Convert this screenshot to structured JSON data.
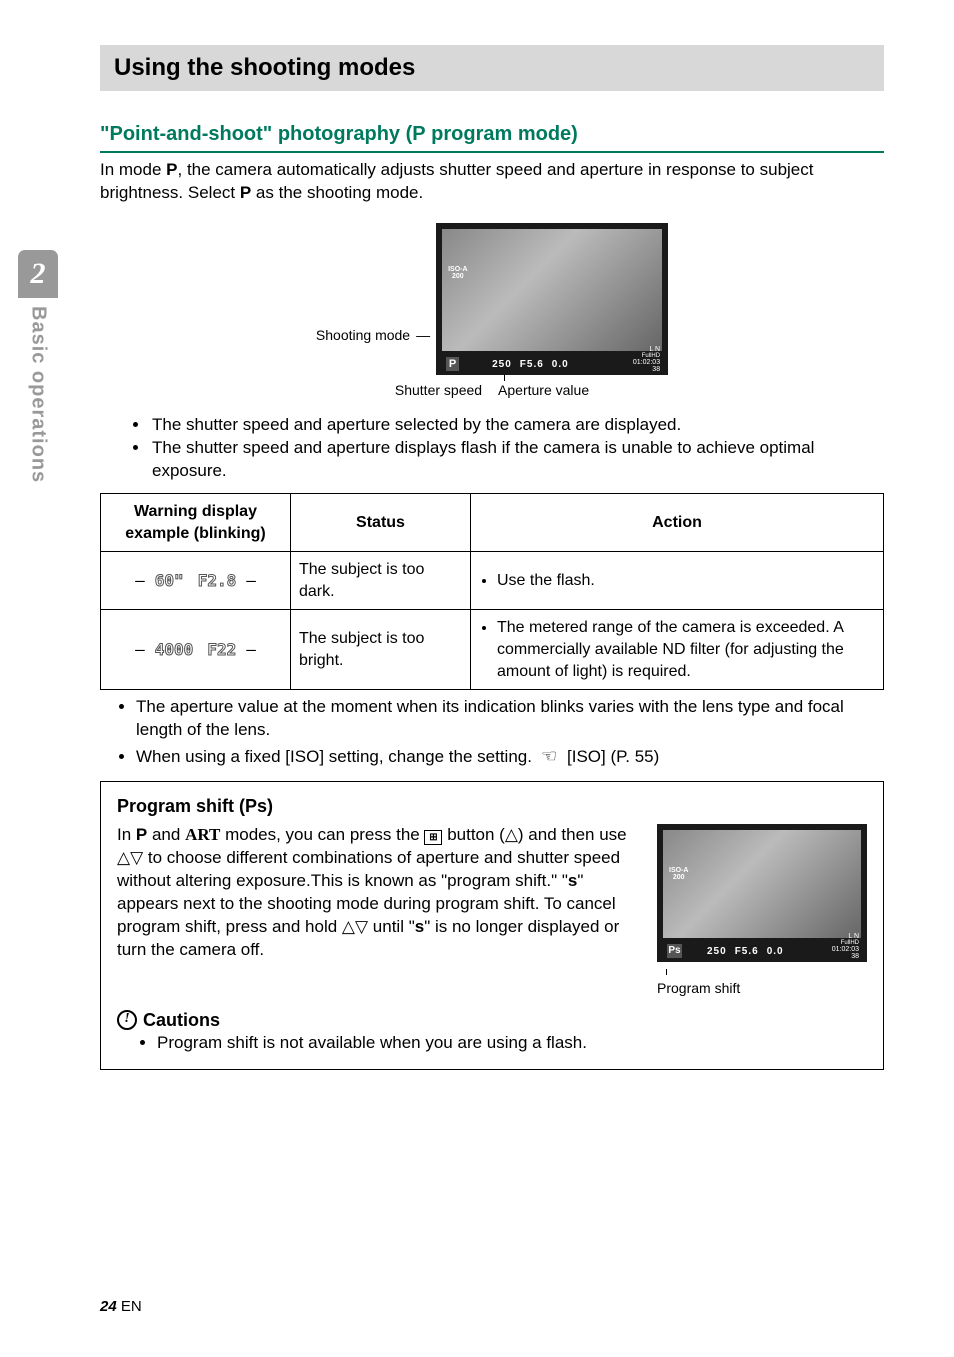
{
  "sideTab": {
    "chapter": "2",
    "label": "Basic operations"
  },
  "title": "Using the shooting modes",
  "section": {
    "heading_pre": "\"Point-and-shoot\" photography (",
    "heading_mode": "P",
    "heading_post": " program mode)",
    "intro1a": "In mode ",
    "intro1b": ", the camera automatically adjusts shutter speed and aperture in response to subject brightness. Select ",
    "intro1c": " as the shooting mode."
  },
  "fig1": {
    "shootingLabel": "Shooting mode",
    "iso": "ISO-A\n200",
    "pmode": "P",
    "shutter": "250",
    "aperture": "F5.6",
    "ev": "0.0",
    "time": "01:02:03",
    "frames": "38",
    "captionShutter": "Shutter speed",
    "captionAperture": "Aperture value"
  },
  "bullets1": [
    "The shutter speed and aperture selected by the camera are displayed.",
    "The shutter speed and aperture displays flash if the camera is unable to achieve optimal exposure."
  ],
  "table": {
    "headers": [
      "Warning display example (blinking)",
      "Status",
      "Action"
    ],
    "rows": [
      {
        "warn": {
          "a": "60\"",
          "b": "F2.8",
          "dashLeft": true,
          "dashRight": true
        },
        "status": "The subject is too dark.",
        "actions": [
          "Use the flash."
        ]
      },
      {
        "warn": {
          "a": "4000",
          "b": "F22",
          "dashLeft": true,
          "dashRight": true
        },
        "status": "The subject is too bright.",
        "actions": [
          "The metered range of the camera is exceeded. A commercially available ND filter (for adjusting the amount of light) is required."
        ]
      }
    ]
  },
  "notes": [
    "The aperture value at the moment when its indication blinks varies with the lens type and focal length of the lens.",
    "When using a fixed [ISO] setting, change the setting."
  ],
  "notesRef": "[ISO] (P. 55)",
  "callout": {
    "heading": "Program shift (Ps)",
    "body_a": "In ",
    "body_mode1": "P",
    "body_b": " and ",
    "body_mode2": "ART",
    "body_c": " modes, you can press the ",
    "body_d": " button (",
    "body_e": ") and then use ",
    "body_f": " to choose different combinations of aperture and shutter speed without altering exposure.This is known as \"program shift.\" \"",
    "body_s1": "s",
    "body_g": "\" appears next to the shooting mode during program shift. To cancel program shift, press and hold ",
    "body_h": " until \"",
    "body_s2": "s",
    "body_i": "\" is no longer displayed or turn the camera off.",
    "figCaption": "Program shift",
    "psMode": "Ps"
  },
  "cautions": {
    "heading": "Cautions",
    "items": [
      "Program shift is not available when you are using a flash."
    ]
  },
  "footer": {
    "page": "24",
    "lang": "EN"
  }
}
